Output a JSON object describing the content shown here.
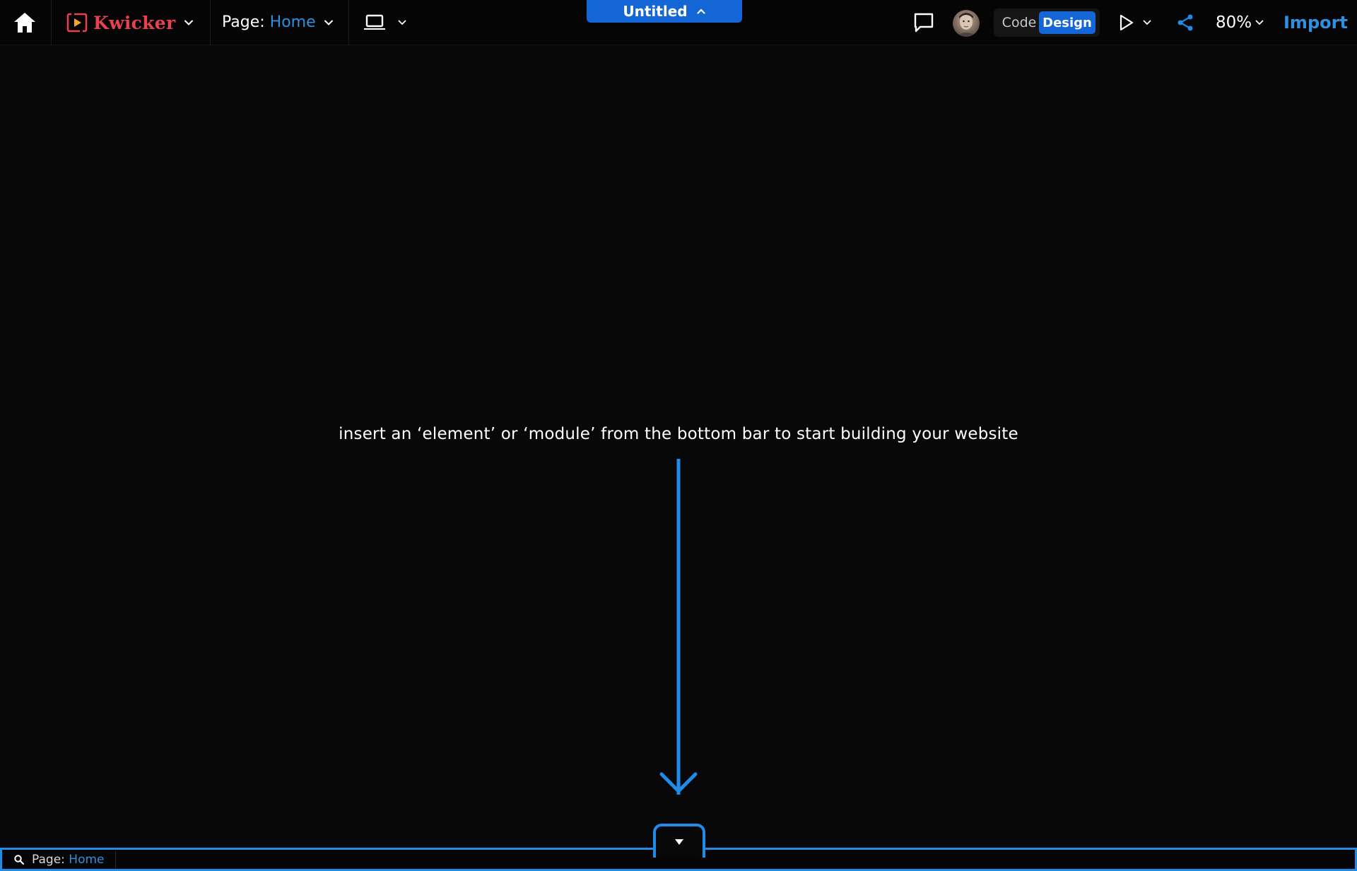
{
  "header": {
    "brand_name": "Kwicker",
    "page_label": "Page:",
    "page_name": "Home",
    "document_title": "Untitled",
    "mode_code_label": "Code",
    "mode_design_label": "Design",
    "active_mode": "Design",
    "zoom_level": "80%",
    "import_label": "Import",
    "icons": [
      "home-icon",
      "kwicker-logo-icon",
      "laptop-icon",
      "chat-bubble-icon",
      "play-icon",
      "share-icon",
      "chevron-down-icon",
      "chevron-up-icon"
    ]
  },
  "canvas": {
    "hint_text": "insert an ‘element’ or ‘module’ from the bottom bar to start building your website"
  },
  "bottom_bar": {
    "page_label": "Page:",
    "page_name": "Home",
    "icons": [
      "search-icon",
      "caret-down-icon"
    ]
  },
  "colors": {
    "background": "#080808",
    "accent_blue": "#1466d6",
    "link_blue": "#2f8fe0",
    "arrow_blue": "#1e8ce8",
    "brand_red": "#e8414f"
  }
}
